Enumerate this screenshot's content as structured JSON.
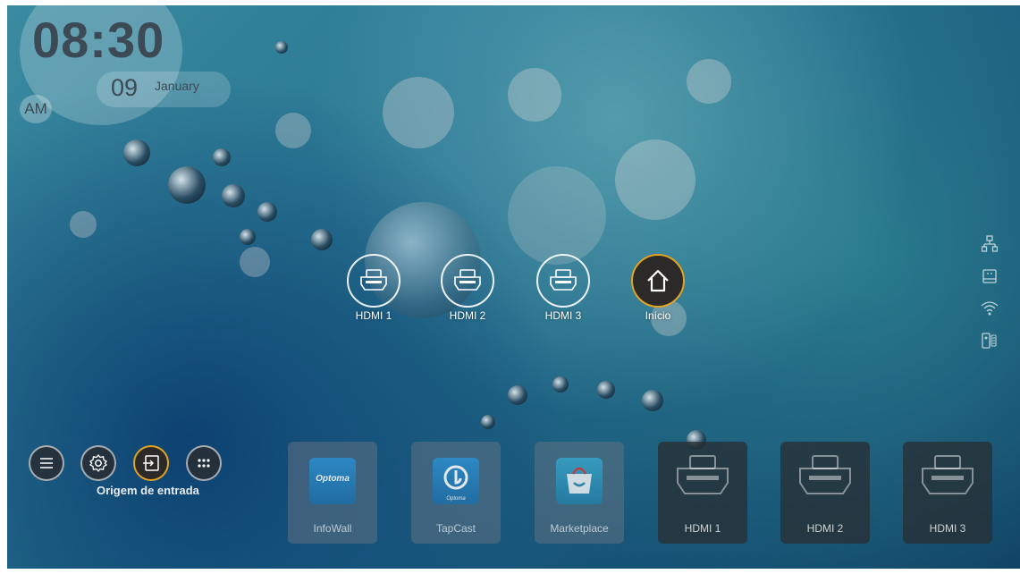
{
  "clock": {
    "time": "08:30",
    "ampm": "AM",
    "day": "09",
    "month": "January"
  },
  "sources": [
    {
      "label": "HDMI 1"
    },
    {
      "label": "HDMI 2"
    },
    {
      "label": "HDMI 3"
    },
    {
      "label": "Início"
    }
  ],
  "status_icons": [
    "network-icon",
    "usb-icon",
    "wifi-icon",
    "remote-icon"
  ],
  "menu": {
    "items": [
      "menu-icon",
      "settings-icon",
      "input-source-icon",
      "apps-icon"
    ],
    "active_label": "Origem de entrada"
  },
  "tiles": [
    {
      "label": "InfoWall",
      "icon_text": "Optoma"
    },
    {
      "label": "TapCast",
      "icon_text": "Optoma"
    },
    {
      "label": "Marketplace"
    },
    {
      "label": "HDMI 1"
    },
    {
      "label": "HDMI 2"
    },
    {
      "label": "HDMI 3"
    }
  ],
  "colors": {
    "accent": "#e2a322",
    "home_bg": "#2b2a28"
  }
}
